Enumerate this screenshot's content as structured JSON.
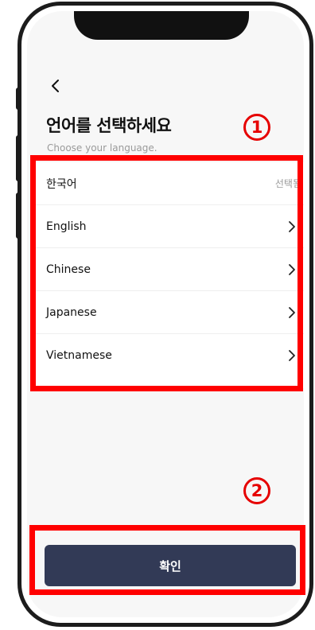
{
  "header": {
    "back_icon": "chevron-left-icon",
    "title": "언어를 선택하세요",
    "subtitle": "Choose your language."
  },
  "languages": [
    {
      "label": "한국어",
      "status": "선택됨",
      "selected": true
    },
    {
      "label": "English",
      "status": "",
      "selected": false
    },
    {
      "label": "Chinese",
      "status": "",
      "selected": false
    },
    {
      "label": "Japanese",
      "status": "",
      "selected": false
    },
    {
      "label": "Vietnamese",
      "status": "",
      "selected": false
    }
  ],
  "footer": {
    "confirm_label": "확인"
  },
  "annotations": {
    "marker_1": "1",
    "marker_2": "2",
    "color": "#ff0000"
  },
  "colors": {
    "button_bg": "#323a56",
    "screen_bg": "#f7f7f7"
  }
}
